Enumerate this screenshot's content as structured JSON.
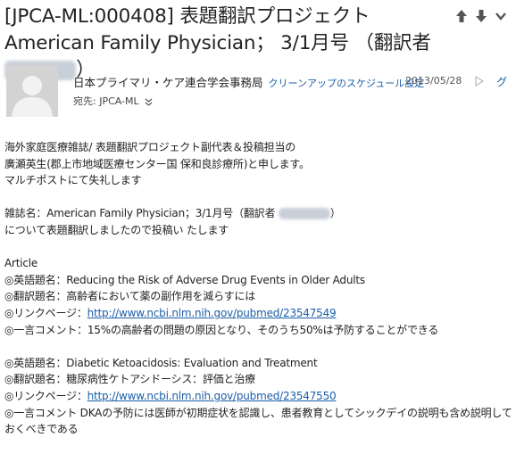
{
  "subject": {
    "text": "[JPCA-ML:000408] 表題翻訳プロジェクト American Family Physician； 3/1月号 （翻訳者",
    "close_paren": "）"
  },
  "header": {
    "sender": "日本プライマリ・ケア連合学会事務局",
    "cleanup_link": "クリーンアップのスケジュール設定",
    "date": "2013/05/28",
    "edge_glyph": "グ",
    "to_label": "宛先:",
    "to_value": "JPCA-ML"
  },
  "body": {
    "intro_1": "海外家庭医療雑誌/ 表題翻訳プロジェクト副代表＆投稿担当の",
    "intro_2": "廣瀬英生(郡上市地域医療センター国 保和良診療所)と申します。",
    "intro_3": "マルチポストにて失礼します",
    "journal_line_prefix": "雑誌名：American Family Physician；3/1月号（翻訳者",
    "journal_line_suffix": "）",
    "journal_line_2": "について表題翻訳しましたので投稿い たします",
    "section_label": "Article",
    "articles": [
      {
        "en_title": "◎英語題名：Reducing the Risk of Adverse Drug Events in Older Adults",
        "ja_title": "◎翻訳題名：高齢者において薬の副作用を減らすには",
        "link_label": "◎リンクページ：",
        "link": "http://www.ncbi.nlm.nih.gov/pubmed/23547549",
        "comment": "◎一言コメント：15%の高齢者の問題の原因となり、そのうち50%は予防することができる"
      },
      {
        "en_title": "◎英語題名：Diabetic Ketoacidosis: Evaluation and Treatment",
        "ja_title": "◎翻訳題名：糖尿病性ケトアシドーシス：評価と治療",
        "link_label": "◎リンクページ：",
        "link": "http://www.ncbi.nlm.nih.gov/pubmed/23547550",
        "comment": "◎一言コメント DKAの予防には医師が初期症状を認識し、患者教育としてシックデイの説明も含め説明しておくべきである"
      }
    ]
  },
  "icons": {
    "up": "arrow-up-icon",
    "down": "arrow-down-icon",
    "more": "chevron-down-icon",
    "avatar": "avatar-placeholder",
    "reply": "reply-icon",
    "expand": "expand-chevron-icon"
  }
}
